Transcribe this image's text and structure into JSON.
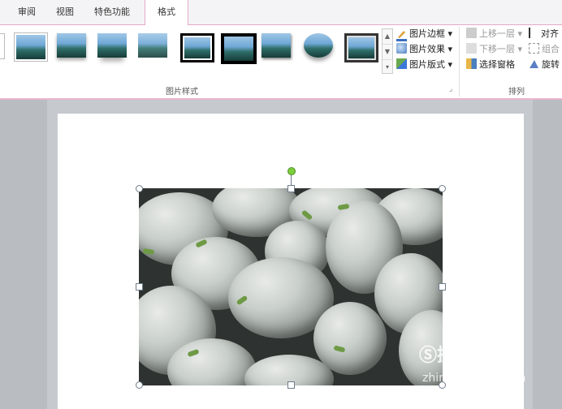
{
  "tabs": [
    {
      "label": "审阅"
    },
    {
      "label": "视图"
    },
    {
      "label": "特色功能"
    },
    {
      "label": "格式"
    }
  ],
  "ribbon": {
    "picture_styles_label": "图片样式",
    "arrange_label": "排列",
    "picture_border": "图片边框",
    "picture_effects": "图片效果",
    "picture_layout": "图片版式",
    "bring_forward": "上移一层",
    "send_backward": "下移一层",
    "selection_pane": "选择窗格",
    "align": "对齐",
    "group": "组合",
    "rotate": "旋转"
  },
  "watermark": {
    "brand": "搜狗指南",
    "url": "zhinan.sogou.com"
  }
}
